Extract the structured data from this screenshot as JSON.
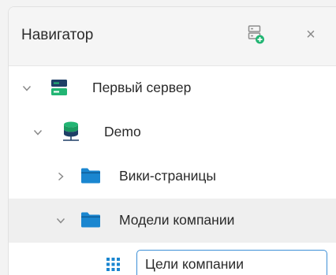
{
  "navigator": {
    "title": "Навигатор",
    "add_server_icon": "add-server-icon",
    "close_icon": "close-icon",
    "close_glyph": "×"
  },
  "tree": {
    "server": {
      "label": "Первый сервер",
      "expanded": true,
      "icon": "server-icon"
    },
    "database": {
      "label": "Demo",
      "expanded": true,
      "icon": "database-icon"
    },
    "wiki_folder": {
      "label": "Вики-страницы",
      "expanded": false,
      "icon": "folder-icon"
    },
    "models_folder": {
      "label": "Модели компании",
      "expanded": true,
      "selected": true,
      "icon": "folder-icon"
    },
    "goals_model": {
      "value": "Цели компании",
      "editing": true,
      "icon": "grid-icon"
    }
  },
  "colors": {
    "accent_blue": "#1a86d0",
    "server_green": "#22b573",
    "server_navy": "#1e3f66",
    "focus_border": "#3d8fd6"
  }
}
